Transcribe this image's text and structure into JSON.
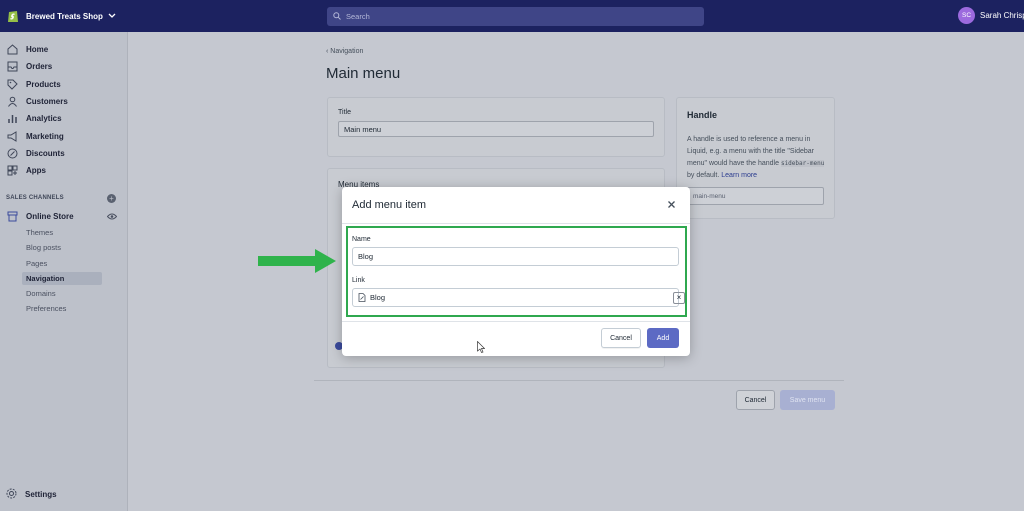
{
  "topbar": {
    "store_name": "Brewed Treats Shop",
    "search_placeholder": "Search",
    "user_initials": "SC",
    "user_name": "Sarah Chrisp"
  },
  "sidebar": {
    "items": [
      {
        "label": "Home",
        "icon": "home-icon"
      },
      {
        "label": "Orders",
        "icon": "orders-icon"
      },
      {
        "label": "Products",
        "icon": "tag-icon"
      },
      {
        "label": "Customers",
        "icon": "person-icon"
      },
      {
        "label": "Analytics",
        "icon": "bar-chart-icon"
      },
      {
        "label": "Marketing",
        "icon": "megaphone-icon"
      },
      {
        "label": "Discounts",
        "icon": "discount-icon"
      },
      {
        "label": "Apps",
        "icon": "apps-icon"
      }
    ],
    "channels_heading": "SALES CHANNELS",
    "online_store": "Online Store",
    "sub_items": [
      "Themes",
      "Blog posts",
      "Pages",
      "Navigation",
      "Domains",
      "Preferences"
    ],
    "active_sub_item": "Navigation",
    "settings": "Settings"
  },
  "page": {
    "back_label": "Navigation",
    "title": "Main menu",
    "title_field_label": "Title",
    "title_field_value": "Main menu",
    "menu_items_heading": "Menu items",
    "handle_heading": "Handle",
    "handle_text_1": "A handle is used to reference a menu in Liquid, e.g. a menu with the title \"Sidebar menu\" would have the handle",
    "handle_code": "sidebar-menu",
    "handle_text_2": "by default.",
    "learn_more": "Learn more",
    "handle_value": "main-menu",
    "cancel_label": "Cancel",
    "save_label": "Save menu"
  },
  "modal": {
    "title": "Add menu item",
    "name_label": "Name",
    "name_value": "Blog",
    "link_label": "Link",
    "link_value": "Blog",
    "cancel_label": "Cancel",
    "add_label": "Add"
  },
  "colors": {
    "topbar": "#1c2260",
    "primary_button": "#5c6ac4",
    "highlight": "#2fa84f",
    "avatar": "#9c6ade"
  }
}
